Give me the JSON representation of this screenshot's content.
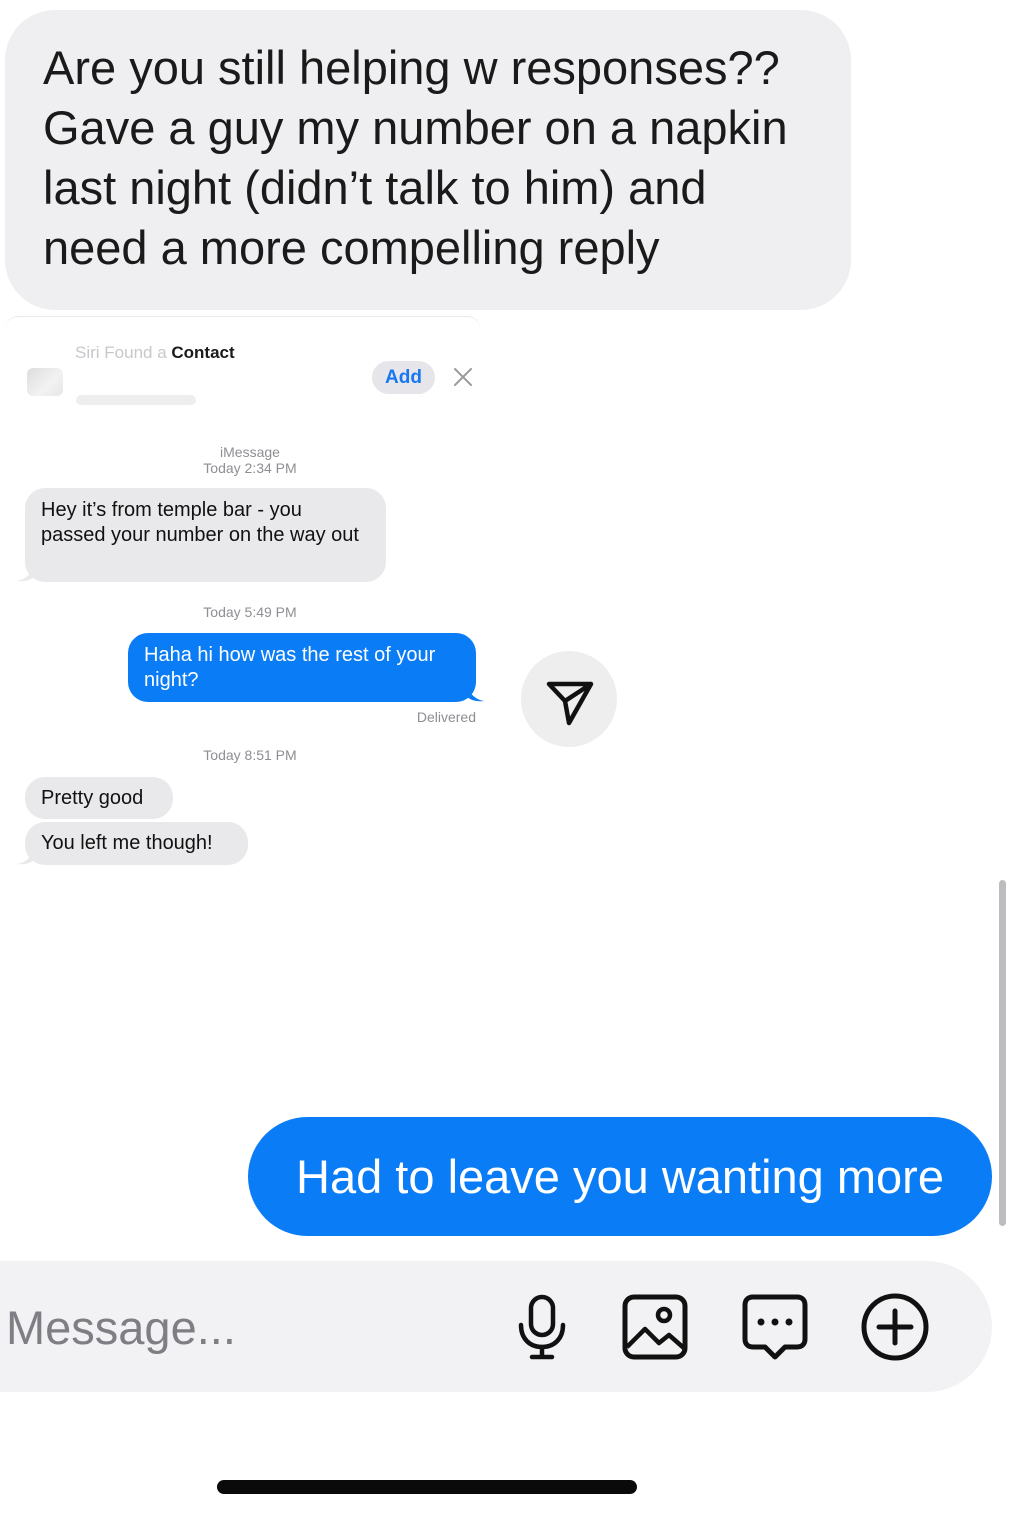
{
  "main_message": {
    "text": "Are you still helping w responses??\nGave a guy my number on a napkin\nlast night (didn’t talk to him) and\nneed a more compelling reply"
  },
  "screenshot": {
    "siri_label_faded": "Siri Found a ",
    "siri_label_bold": "Contact",
    "add_label": "Add",
    "service_label": "iMessage",
    "timestamp_1": "Today 2:34 PM",
    "received_1": "Hey it’s       from temple bar - you passed your number on the way out",
    "timestamp_2": "Today 5:49 PM",
    "sent_1": "Haha hi how was the rest of your night?",
    "delivered_label": "Delivered",
    "timestamp_3": "Today 8:51 PM",
    "received_2": "Pretty good",
    "received_3": "You left me though!"
  },
  "reply_message": {
    "text": "Had to leave you wanting more"
  },
  "composer": {
    "placeholder": "Message..."
  },
  "icons": {
    "share": "paper-plane-icon",
    "mic": "microphone-icon",
    "image": "image-icon",
    "chat": "chat-bubble-icon",
    "plus": "plus-circle-icon",
    "close": "close-icon"
  },
  "colors": {
    "sent_bubble": "#0a7cf6",
    "received_bubble": "#e9e9eb",
    "add_text": "#1877f2"
  }
}
